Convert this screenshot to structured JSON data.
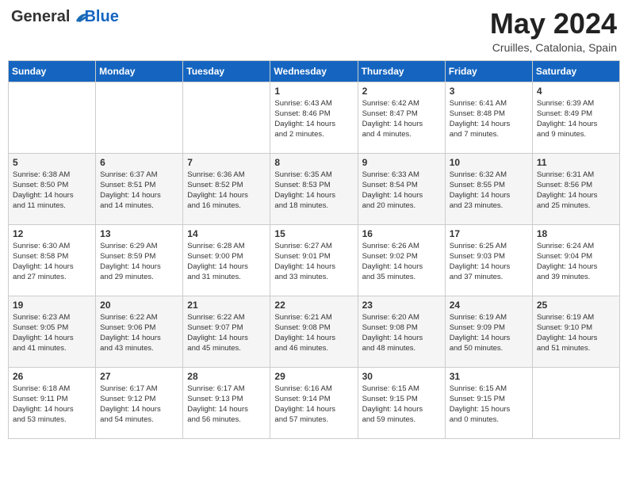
{
  "header": {
    "logo_general": "General",
    "logo_blue": "Blue",
    "month_year": "May 2024",
    "location": "Cruilles, Catalonia, Spain"
  },
  "days_of_week": [
    "Sunday",
    "Monday",
    "Tuesday",
    "Wednesday",
    "Thursday",
    "Friday",
    "Saturday"
  ],
  "weeks": [
    [
      {
        "day": "",
        "content": ""
      },
      {
        "day": "",
        "content": ""
      },
      {
        "day": "",
        "content": ""
      },
      {
        "day": "1",
        "content": "Sunrise: 6:43 AM\nSunset: 8:46 PM\nDaylight: 14 hours\nand 2 minutes."
      },
      {
        "day": "2",
        "content": "Sunrise: 6:42 AM\nSunset: 8:47 PM\nDaylight: 14 hours\nand 4 minutes."
      },
      {
        "day": "3",
        "content": "Sunrise: 6:41 AM\nSunset: 8:48 PM\nDaylight: 14 hours\nand 7 minutes."
      },
      {
        "day": "4",
        "content": "Sunrise: 6:39 AM\nSunset: 8:49 PM\nDaylight: 14 hours\nand 9 minutes."
      }
    ],
    [
      {
        "day": "5",
        "content": "Sunrise: 6:38 AM\nSunset: 8:50 PM\nDaylight: 14 hours\nand 11 minutes."
      },
      {
        "day": "6",
        "content": "Sunrise: 6:37 AM\nSunset: 8:51 PM\nDaylight: 14 hours\nand 14 minutes."
      },
      {
        "day": "7",
        "content": "Sunrise: 6:36 AM\nSunset: 8:52 PM\nDaylight: 14 hours\nand 16 minutes."
      },
      {
        "day": "8",
        "content": "Sunrise: 6:35 AM\nSunset: 8:53 PM\nDaylight: 14 hours\nand 18 minutes."
      },
      {
        "day": "9",
        "content": "Sunrise: 6:33 AM\nSunset: 8:54 PM\nDaylight: 14 hours\nand 20 minutes."
      },
      {
        "day": "10",
        "content": "Sunrise: 6:32 AM\nSunset: 8:55 PM\nDaylight: 14 hours\nand 23 minutes."
      },
      {
        "day": "11",
        "content": "Sunrise: 6:31 AM\nSunset: 8:56 PM\nDaylight: 14 hours\nand 25 minutes."
      }
    ],
    [
      {
        "day": "12",
        "content": "Sunrise: 6:30 AM\nSunset: 8:58 PM\nDaylight: 14 hours\nand 27 minutes."
      },
      {
        "day": "13",
        "content": "Sunrise: 6:29 AM\nSunset: 8:59 PM\nDaylight: 14 hours\nand 29 minutes."
      },
      {
        "day": "14",
        "content": "Sunrise: 6:28 AM\nSunset: 9:00 PM\nDaylight: 14 hours\nand 31 minutes."
      },
      {
        "day": "15",
        "content": "Sunrise: 6:27 AM\nSunset: 9:01 PM\nDaylight: 14 hours\nand 33 minutes."
      },
      {
        "day": "16",
        "content": "Sunrise: 6:26 AM\nSunset: 9:02 PM\nDaylight: 14 hours\nand 35 minutes."
      },
      {
        "day": "17",
        "content": "Sunrise: 6:25 AM\nSunset: 9:03 PM\nDaylight: 14 hours\nand 37 minutes."
      },
      {
        "day": "18",
        "content": "Sunrise: 6:24 AM\nSunset: 9:04 PM\nDaylight: 14 hours\nand 39 minutes."
      }
    ],
    [
      {
        "day": "19",
        "content": "Sunrise: 6:23 AM\nSunset: 9:05 PM\nDaylight: 14 hours\nand 41 minutes."
      },
      {
        "day": "20",
        "content": "Sunrise: 6:22 AM\nSunset: 9:06 PM\nDaylight: 14 hours\nand 43 minutes."
      },
      {
        "day": "21",
        "content": "Sunrise: 6:22 AM\nSunset: 9:07 PM\nDaylight: 14 hours\nand 45 minutes."
      },
      {
        "day": "22",
        "content": "Sunrise: 6:21 AM\nSunset: 9:08 PM\nDaylight: 14 hours\nand 46 minutes."
      },
      {
        "day": "23",
        "content": "Sunrise: 6:20 AM\nSunset: 9:08 PM\nDaylight: 14 hours\nand 48 minutes."
      },
      {
        "day": "24",
        "content": "Sunrise: 6:19 AM\nSunset: 9:09 PM\nDaylight: 14 hours\nand 50 minutes."
      },
      {
        "day": "25",
        "content": "Sunrise: 6:19 AM\nSunset: 9:10 PM\nDaylight: 14 hours\nand 51 minutes."
      }
    ],
    [
      {
        "day": "26",
        "content": "Sunrise: 6:18 AM\nSunset: 9:11 PM\nDaylight: 14 hours\nand 53 minutes."
      },
      {
        "day": "27",
        "content": "Sunrise: 6:17 AM\nSunset: 9:12 PM\nDaylight: 14 hours\nand 54 minutes."
      },
      {
        "day": "28",
        "content": "Sunrise: 6:17 AM\nSunset: 9:13 PM\nDaylight: 14 hours\nand 56 minutes."
      },
      {
        "day": "29",
        "content": "Sunrise: 6:16 AM\nSunset: 9:14 PM\nDaylight: 14 hours\nand 57 minutes."
      },
      {
        "day": "30",
        "content": "Sunrise: 6:15 AM\nSunset: 9:15 PM\nDaylight: 14 hours\nand 59 minutes."
      },
      {
        "day": "31",
        "content": "Sunrise: 6:15 AM\nSunset: 9:15 PM\nDaylight: 15 hours\nand 0 minutes."
      },
      {
        "day": "",
        "content": ""
      }
    ]
  ]
}
